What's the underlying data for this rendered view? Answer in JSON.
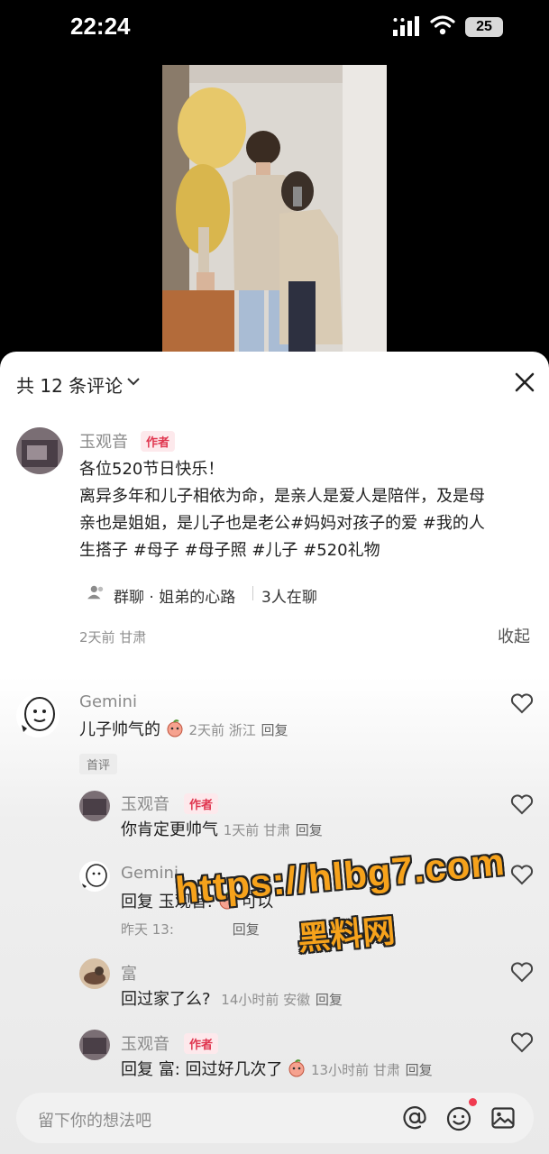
{
  "status": {
    "time": "22:24",
    "battery": "25"
  },
  "header": {
    "count_label": "共 12 条评论"
  },
  "post": {
    "author": "玉观音",
    "badge": "作者",
    "lines": [
      "各位520节日快乐！",
      "离异多年和儿子相依为命，是亲人是爱人是陪伴，及是母",
      "亲也是姐姐，是儿子也是老公#妈妈对孩子的爱 #我的人",
      "生搭子 #母子 #母子照 #儿子 #520礼物"
    ],
    "group_label": "群聊 · 姐弟的心路",
    "group_count": "3人在聊",
    "time_loc": "2天前 甘肃",
    "collapse": "收起"
  },
  "comments": [
    {
      "name": "Gemini",
      "text": "儿子帅气的",
      "meta": "2天前 浙江",
      "reply": "回复",
      "tag": "首评"
    },
    {
      "name": "玉观音",
      "badge": "作者",
      "text": "你肯定更帅气",
      "meta": "1天前 甘肃",
      "reply": "回复"
    },
    {
      "name": "Gemini",
      "text_prefix": "回复 玉观音:",
      "text_suffix": "可以",
      "meta": "昨天 13:",
      "reply": "回复"
    },
    {
      "name": "富",
      "text": "回过家了么?",
      "meta": "14小时前 安徽",
      "reply": "回复"
    },
    {
      "name": "玉观音",
      "badge": "作者",
      "text_prefix": "回复 富: 回过好几次了",
      "meta": "13小时前 甘肃",
      "reply": "回复"
    }
  ],
  "input": {
    "placeholder": "留下你的想法吧"
  },
  "watermark": {
    "line1": "https://hlbg7.com",
    "line2": "黑料网"
  },
  "colors": {
    "accent": "#e0364f",
    "watermark": "#f6a21b"
  },
  "icons": [
    "signal-icon",
    "wifi-icon",
    "chevron-down-icon",
    "close-icon",
    "group-icon",
    "heart-icon",
    "at-icon",
    "emoji-icon",
    "image-icon",
    "peach-emoji-icon"
  ]
}
